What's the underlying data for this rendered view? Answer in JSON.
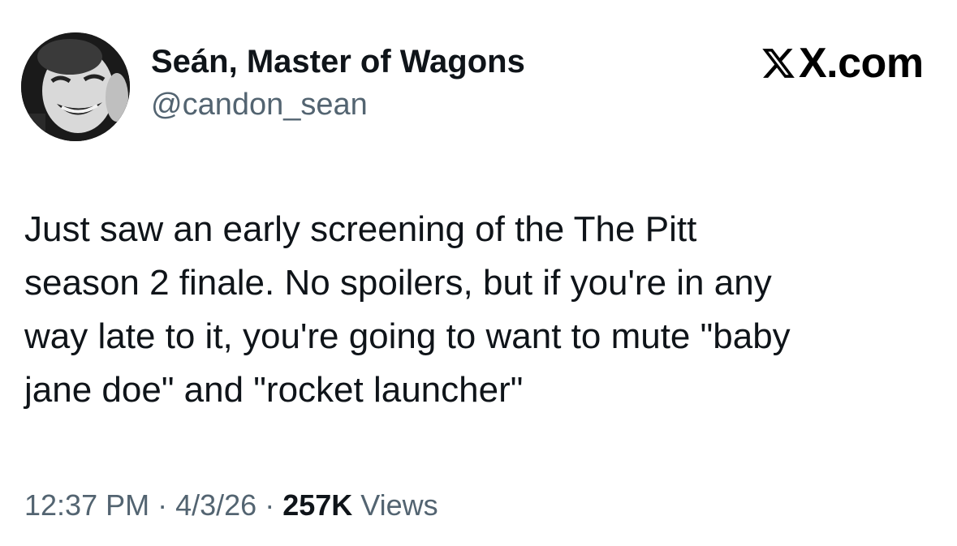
{
  "author": {
    "display_name": "Seán, Master of Wagons",
    "handle": "@candon_sean",
    "avatar_icon": "avatar-photo"
  },
  "brand": {
    "logo_icon": "x-logo-icon",
    "text": "X.com"
  },
  "tweet": {
    "lines": [
      "Just saw an early screening of the The Pitt",
      "season 2 finale. No spoilers, but if you're in any",
      "way late to it, you're going to want to mute \"baby",
      "jane doe\" and \"rocket launcher\""
    ]
  },
  "meta": {
    "time": "12:37 PM",
    "separator": " · ",
    "date": "4/3/26",
    "views_count": "257K",
    "views_label": " Views"
  },
  "colors": {
    "text_primary": "#0f1419",
    "text_secondary": "#536471",
    "background": "#ffffff"
  }
}
